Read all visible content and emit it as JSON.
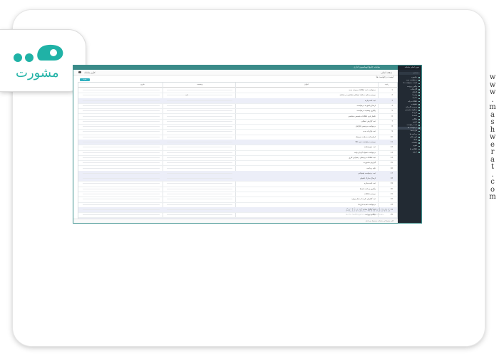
{
  "site": {
    "logo_text": "مشورت",
    "url_vertical": "www.mashwerat.com",
    "brand_color": "#20b2a6"
  },
  "app": {
    "title": "سامانه جامع اتوماسیون اداری",
    "user_label": "کاربر سامانه",
    "home_label": "صفحه اصلی",
    "breadcrumb": "لیست درخواست ها",
    "new_button": "جدید"
  },
  "sidebar": {
    "header": "منوی اصلی سامانه",
    "search_placeholder": "جستجو",
    "items": [
      {
        "label": "داشبورد",
        "active": false
      },
      {
        "label": "درخواست جدید",
        "active": false
      },
      {
        "label": "لیست درخواست ها",
        "active": false
      },
      {
        "label": "پیگیری پرونده",
        "active": false
      },
      {
        "label": "گزارشات",
        "active": false
      },
      {
        "label": "کارتابل",
        "active": false
      },
      {
        "label": "پیام ها",
        "active": false
      },
      {
        "label": "مدارک",
        "active": false
      },
      {
        "label": "اطلاعات پایه",
        "active": false
      },
      {
        "label": "تنظیمات",
        "active": false
      },
      {
        "label": "مدیریت کاربران",
        "active": false
      },
      {
        "label": "سطوح دسترسی",
        "active": false
      },
      {
        "label": "فرم ها",
        "active": false
      },
      {
        "label": "نامه ها",
        "active": false
      },
      {
        "label": "بایگانی",
        "active": false
      },
      {
        "label": "آرشیو",
        "active": false
      },
      {
        "label": "ثبت درخواست",
        "active": false
      },
      {
        "label": "درخواست ها",
        "active": true
      },
      {
        "label": "قراردادها",
        "active": false
      },
      {
        "label": "پرداخت ها",
        "active": false
      },
      {
        "label": "امور مالی",
        "active": false
      },
      {
        "label": "اسناد",
        "active": false
      },
      {
        "label": "جلسات",
        "active": false
      },
      {
        "label": "تقویم",
        "active": false
      },
      {
        "label": "اطلاعیه ها",
        "active": false
      },
      {
        "label": "خروج",
        "active": false
      }
    ]
  },
  "table": {
    "headers": [
      "شرح",
      "وضعیت",
      "عنوان",
      "ردیف"
    ],
    "rows": [
      {
        "title": "درخواست ثبت اطلاعات پرونده جدید",
        "num": "1",
        "mid": "",
        "alt": false
      },
      {
        "title": "بررسی و تایید مدارک ارسالی متقاضی در سامانه",
        "num": "2",
        "mid": "تایید",
        "alt": false
      },
      {
        "title": "ثبت نامه وارده",
        "num": "3",
        "mid": "",
        "alt": true
      },
      {
        "title": "ارسال پاسخ به درخواست",
        "num": "4",
        "mid": "",
        "alt": false
      },
      {
        "title": "پیگیری وضعیت درخواست",
        "num": "5",
        "mid": "",
        "alt": false
      },
      {
        "title": "تکمیل فرم اطلاعات شخصی متقاضی",
        "num": "6",
        "mid": "",
        "alt": false
      },
      {
        "title": "ثبت گزارش عملکرد",
        "num": "7",
        "mid": "",
        "alt": false
      },
      {
        "title": "درخواست مرخصی کارکنان",
        "num": "8",
        "mid": "",
        "alt": false
      },
      {
        "title": "ثبت قرارداد جدید",
        "num": "9",
        "mid": "",
        "alt": false
      },
      {
        "title": "ارجاع نامه به واحد مربوطه",
        "num": "10",
        "mid": "",
        "alt": false
      },
      {
        "title": "بررسی درخواست خرید کالا",
        "num": "11",
        "mid": "",
        "alt": true
      },
      {
        "title": "ثبت صورتجلسه",
        "num": "12",
        "mid": "",
        "alt": false
      },
      {
        "title": "درخواست تنخواه گردان واحد",
        "num": "13",
        "mid": "",
        "alt": false
      },
      {
        "title": "ثبت اطلاعات پرسنلی و سوابق کاری",
        "num": "14",
        "mid": "",
        "alt": false
      },
      {
        "title": "گزارش ماموریت",
        "num": "15",
        "mid": "",
        "alt": false
      },
      {
        "title": "تایید پرداخت",
        "num": "16",
        "mid": "",
        "alt": false
      },
      {
        "title": "ثبت درخواست پشتیبانی",
        "num": "17",
        "mid": "",
        "alt": true
      },
      {
        "title": "ارسال مدارک تکمیلی",
        "num": "18",
        "mid": "",
        "alt": true
      },
      {
        "title": "ثبت نامه صادره",
        "num": "19",
        "mid": "",
        "alt": false
      },
      {
        "title": "پیگیری پرداخت قسط",
        "num": "20",
        "mid": "",
        "alt": false
      },
      {
        "title": "بررسی شکایات",
        "num": "21",
        "mid": "",
        "alt": false
      },
      {
        "title": "ثبت گزارش بازدید از محل پروژه",
        "num": "22",
        "mid": "",
        "alt": false
      },
      {
        "title": "درخواست تمدید قرارداد",
        "num": "23",
        "mid": "",
        "alt": false
      },
      {
        "title": "ثبت دستور جلسه",
        "num": "24",
        "mid": "",
        "alt": true
      },
      {
        "title": "بایگانی پرونده",
        "num": "25",
        "mid": "",
        "alt": false
      },
      {
        "title": "ثبت نهایی",
        "num": "26",
        "mid": "",
        "alt": true
      }
    ]
  },
  "watermark": {
    "title": "Activate Windows",
    "subtitle": "Go to Settings to activate Windows."
  },
  "footer": {
    "text": "کلیه حقوق این سامانه محفوظ می باشد"
  }
}
